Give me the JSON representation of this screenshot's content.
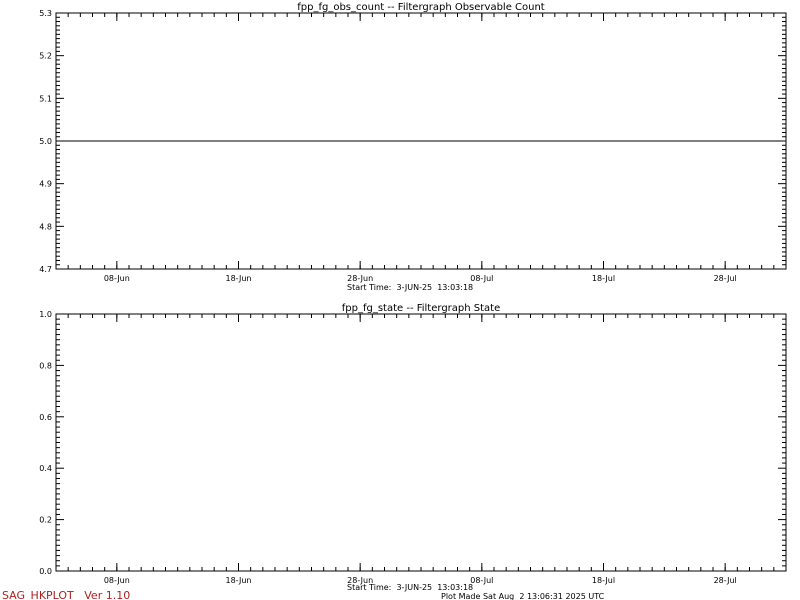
{
  "chart_data": [
    {
      "type": "line",
      "title": "fpp_fg_obs_count -- Filtergraph Observable Count",
      "x_ticks": [
        "08-Jun",
        "18-Jun",
        "28-Jun",
        "08-Jul",
        "18-Jul",
        "28-Jul"
      ],
      "x_range": [
        "2025-06-03",
        "2025-08-02"
      ],
      "x_tick_dates": [
        "2025-06-08",
        "2025-06-18",
        "2025-06-28",
        "2025-07-08",
        "2025-07-18",
        "2025-07-28"
      ],
      "ylim": [
        4.7,
        5.3
      ],
      "y_ticks": [
        4.7,
        4.8,
        4.9,
        5.0,
        5.1,
        5.2,
        5.3
      ],
      "y_tick_labels": [
        "4.7",
        "4.8",
        "4.9",
        "5.0",
        "5.1",
        "5.2",
        "5.3"
      ],
      "series": [
        {
          "x": [
            "2025-06-03",
            "2025-08-02"
          ],
          "y": [
            5.0,
            5.0
          ]
        }
      ],
      "start_time": "Start Time:  3-JUN-25  13:03:18",
      "grid": false
    },
    {
      "type": "line",
      "title": "fpp_fg_state -- Filtergraph State",
      "x_ticks": [
        "08-Jun",
        "18-Jun",
        "28-Jun",
        "08-Jul",
        "18-Jul",
        "28-Jul"
      ],
      "x_range": [
        "2025-06-03",
        "2025-08-02"
      ],
      "x_tick_dates": [
        "2025-06-08",
        "2025-06-18",
        "2025-06-28",
        "2025-07-08",
        "2025-07-18",
        "2025-07-28"
      ],
      "ylim": [
        0.0,
        1.0
      ],
      "y_ticks": [
        0.0,
        0.2,
        0.4,
        0.6,
        0.8,
        1.0
      ],
      "y_tick_labels": [
        "0.0",
        "0.2",
        "0.4",
        "0.6",
        "0.8",
        "1.0"
      ],
      "series": [],
      "start_time": "Start Time:  3-JUN-25  13:03:18",
      "grid": false
    }
  ],
  "footer": {
    "program": "SAG_HKPLOT   Ver 1.10",
    "plot_made": "Plot Made Sat Aug  2 13:06:31 2025 UTC"
  },
  "colors": {
    "program_label": "#b02020",
    "axes": "#000000",
    "background": "#ffffff"
  }
}
